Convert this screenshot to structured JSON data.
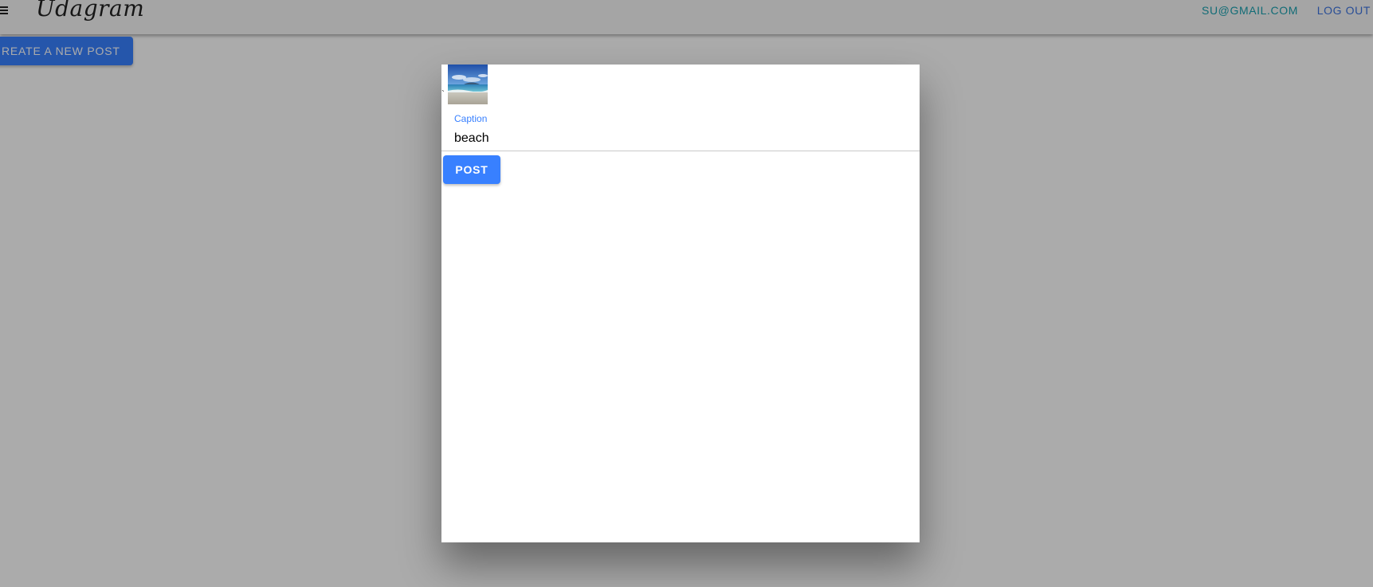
{
  "app": {
    "title": "Udagram",
    "user_email": "SU@GMAIL.COM",
    "logout_label": "LOG OUT",
    "menu_icon": "hamburger-menu-icon"
  },
  "actions": {
    "create_post_label": "REATE A NEW POST"
  },
  "modal": {
    "back_glyph": "`",
    "image": {
      "icon": "beach-photo-thumbnail"
    },
    "caption_label": "Caption",
    "caption_value": "beach",
    "post_label": "POST"
  },
  "colors": {
    "primary": "#3880ff",
    "email": "#1aa1b0",
    "logout": "#3d74e0"
  }
}
